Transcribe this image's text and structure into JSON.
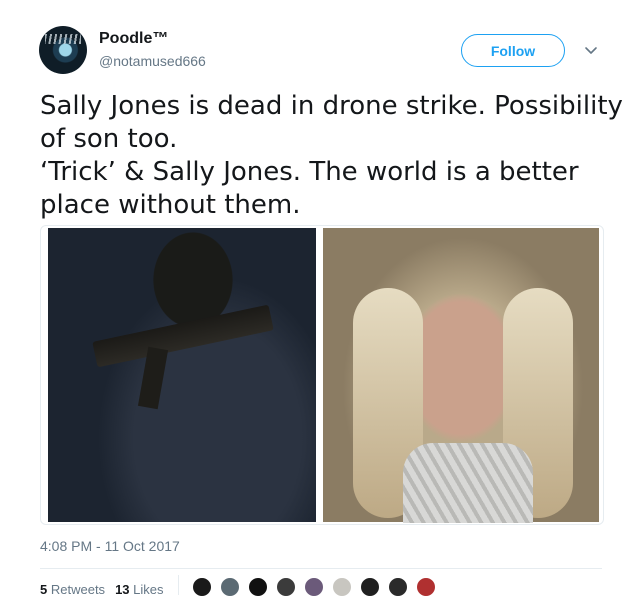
{
  "author": {
    "display_name": "Poodle™",
    "handle": "@notamused666",
    "avatar_icon": "avatar-icon"
  },
  "follow_label": "Follow",
  "tweet": {
    "lines": [
      "Sally Jones is dead in drone strike. Possibility",
      "of son too.",
      "‘Trick’ & Sally Jones. The world is a better",
      "place without them."
    ]
  },
  "timestamp": "4:08 PM - 11 Oct 2017",
  "stats": {
    "retweets_count": "5",
    "retweets_label": "Retweets",
    "likes_count": "13",
    "likes_label": "Likes"
  },
  "likers": [
    {
      "color": "#1a1a1a"
    },
    {
      "color": "#5b6a73"
    },
    {
      "color": "#111111"
    },
    {
      "color": "#3b3b3b"
    },
    {
      "color": "#6b5a7a"
    },
    {
      "color": "#c8c6c0"
    },
    {
      "color": "#202020"
    },
    {
      "color": "#2a2a2a"
    },
    {
      "color": "#b03030"
    }
  ],
  "colors": {
    "accent": "#1da1f2",
    "text_primary": "#14171a",
    "text_secondary": "#657786",
    "border": "#e6ecf0"
  }
}
